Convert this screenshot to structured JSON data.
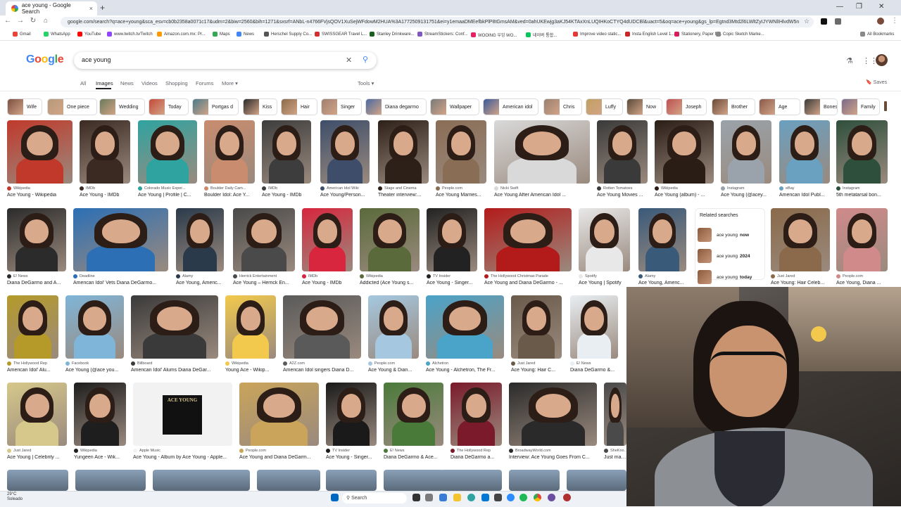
{
  "browser": {
    "tab_title": "ace young - Google Search",
    "tab_close": "×",
    "new_tab": "+",
    "url": "google.com/search?q=ace+young&sca_esv=cb0b2358a0071c17&udm=2&biw=2560&bih=1271&sxsrf=ANbL-n4766FVjsQOV1XuSejWFdowM2HUA%3A1772509131751&ei=y1emaaDMEefbkPlP8tGmsAM&ved=0ahUKEwjg3aKJ54KTAxXnLUQIHKoCTYQ4dUDCBl&uact=5&oq=ace+young&gs_lp=Egtnd3Mtd2l6LWltZyIJYWNlIHlvdW5n",
    "nav": {
      "back": "←",
      "forward": "→",
      "reload": "↻",
      "home": "⌂"
    },
    "window_controls": {
      "minimize": "—",
      "restore": "❐",
      "close": "✕"
    },
    "bookmarks": [
      "Gmail",
      "WhatsApp",
      "YouTube",
      "www.twitch.tv/Twitch",
      "Amazon.com.mx: Pr...",
      "Maps",
      "News",
      "Herschel Supply Co...",
      "SWISSGEAR Travel L...",
      "Stanley Drinkware...",
      "StreamStickers: Conf...",
      "WOOING 우잉 WO...",
      "네이버 통합...",
      "Improve video static...",
      "Insta English Level 1...",
      "Stationery, Paper fo...",
      "Copic Sketch Marke..."
    ],
    "all_bookmarks": "All Bookmarks"
  },
  "google": {
    "logo": {
      "letters": [
        "G",
        "o",
        "o",
        "g",
        "l",
        "e"
      ],
      "colors": [
        "#4285f4",
        "#ea4335",
        "#fbbc05",
        "#4285f4",
        "#34a853",
        "#ea4335"
      ]
    },
    "query": "ace young",
    "clear_icon": "✕",
    "search_icon": "⚲",
    "tabs": [
      "All",
      "Images",
      "News",
      "Videos",
      "Shopping",
      "Forums",
      "More ▾"
    ],
    "active_tab": "Images",
    "tools": "Tools ▾",
    "saves": "Saves",
    "chips": [
      "Wife",
      "One piece",
      "Wedding",
      "Today",
      "Portgas d",
      "Kiss",
      "Hair",
      "Singer",
      "Diana degarmo",
      "Wallpaper",
      "American idol",
      "Chris",
      "Luffy",
      "Now",
      "Joseph",
      "Brother",
      "Age",
      "Bones",
      "Family"
    ],
    "related": {
      "heading": "Related searches",
      "items": [
        {
          "base": "ace young",
          "bold": "now"
        },
        {
          "base": "ace young",
          "bold": "2024"
        },
        {
          "base": "ace young",
          "bold": "today"
        }
      ]
    },
    "results": [
      {
        "source": "Wikipedia",
        "title": "Ace Young - Wikipedia",
        "accent": "#c0392b"
      },
      {
        "source": "IMDb",
        "title": "Ace Young - IMDb",
        "accent": "#3b2a22"
      },
      {
        "source": "Colorado Music Exper...",
        "title": "Ace Young | Profile | C...",
        "accent": "#2fa3a0"
      },
      {
        "source": "Boulder Daily Cam...",
        "title": "Boulder Idol: Ace Y...",
        "accent": "#c98c6e"
      },
      {
        "source": "IMDb",
        "title": "Ace Young - IMDb",
        "accent": "#3d3d3d"
      },
      {
        "source": "American Idol Wiki",
        "title": "Ace Young/Person...",
        "accent": "#3e4e6a"
      },
      {
        "source": "Stage and Cinema",
        "title": "Theater interview:...",
        "accent": "#2d2018"
      },
      {
        "source": "People.com",
        "title": "Ace Young Marries...",
        "accent": "#8a6d55"
      },
      {
        "source": "Nicki Swift",
        "title": "Ace Young After American Idol ...",
        "accent": "#d9d9d9"
      },
      {
        "source": "Rotten Tomatoes",
        "title": "Ace Young Movies ...",
        "accent": "#3a3a3a"
      },
      {
        "source": "Wikipedia",
        "title": "Ace Young (album) - ...",
        "accent": "#2a1d15"
      },
      {
        "source": "Instagram",
        "title": "Ace Young (@acey...",
        "accent": "#9aa3ab"
      },
      {
        "source": "eBay",
        "title": "American Idol Publ...",
        "accent": "#6aa0c0"
      },
      {
        "source": "Instagram",
        "title": "5th metatarsal bon...",
        "accent": "#2e4f3c"
      },
      {
        "source": "E! News",
        "title": "Diana DeGarmo and A...",
        "accent": "#2b2b2b"
      },
      {
        "source": "Deadline",
        "title": "American Idol' Vets Diana DeGarmo...",
        "accent": "#2c6fb5"
      },
      {
        "source": "Alamy",
        "title": "Ace Young, Americ...",
        "accent": "#2a3a4a"
      },
      {
        "source": "Herrick Entertainment",
        "title": "Ace Young – Herrick En...",
        "accent": "#4a4a4a"
      },
      {
        "source": "IMDb",
        "title": "Ace Young - IMDb",
        "accent": "#d7263d"
      },
      {
        "source": "Wikipedia",
        "title": "Addicted (Ace Young s...",
        "accent": "#5a6a3a"
      },
      {
        "source": "TV Insider",
        "title": "Ace Young - Singer...",
        "accent": "#222222"
      },
      {
        "source": "The Hollywood Christmas Parade",
        "title": "Ace Young and Diana DeGarmo - ...",
        "accent": "#b31b1b"
      },
      {
        "source": "Spotify",
        "title": "Ace Young | Spotify",
        "accent": "#e8e8e8"
      },
      {
        "source": "Alamy",
        "title": "Ace Young, Americ...",
        "accent": "#3a5a7a"
      },
      {
        "source": "Just Jared",
        "title": "Ace Young: Hair Celeb...",
        "accent": "#8a6a4a"
      },
      {
        "source": "People.com",
        "title": "Ace Young, Diana ...",
        "accent": "#d08a8a"
      },
      {
        "source": "The Hollywood Rep",
        "title": "American Idol' Alu...",
        "accent": "#b59a2a"
      },
      {
        "source": "Facebook",
        "title": "Ace Young (@ace you...",
        "accent": "#7fb5d8"
      },
      {
        "source": "Billboard",
        "title": "American Idol' Alums Diana DeGar...",
        "accent": "#3a3a3a"
      },
      {
        "source": "Wikipedia",
        "title": "Young Ace - Wikip...",
        "accent": "#f2c94c"
      },
      {
        "source": "A2Z.com",
        "title": "American Idol singers Diana D...",
        "accent": "#5a5a5a"
      },
      {
        "source": "People.com",
        "title": "Ace Young & Dian...",
        "accent": "#a5c8e0"
      },
      {
        "source": "Alchetron",
        "title": "Ace Young - Alchetron, The Fr...",
        "accent": "#4aa3c8"
      },
      {
        "source": "Just Jared",
        "title": "Ace Young: Hair C...",
        "accent": "#6a5a4a"
      },
      {
        "source": "E! News",
        "title": "Diana DeGarmo &...",
        "accent": "#e9eef2"
      },
      {
        "source": "Just Jared",
        "title": "Ace Young | Celebrity ...",
        "accent": "#d6c88a"
      },
      {
        "source": "Wikipedia",
        "title": "Yungeen Ace - Wik...",
        "accent": "#1e1e1e"
      },
      {
        "source": "Apple Music",
        "title": "Ace Young - Album by Ace Young - Apple...",
        "accent": "#f2f2f2"
      },
      {
        "source": "People.com",
        "title": "Ace Young and Diana DeGarm...",
        "accent": "#c9a45a"
      },
      {
        "source": "TV Insider",
        "title": "Ace Young - Singer...",
        "accent": "#1a1a1a"
      },
      {
        "source": "E! News",
        "title": "Diana DeGarmo & Ace...",
        "accent": "#4a7a3a"
      },
      {
        "source": "The Hollywood Rep",
        "title": "Diana DeGarmo a...",
        "accent": "#7a1a2a"
      },
      {
        "source": "BroadwayWorld.com",
        "title": "Interview: Ace Young Goes From C...",
        "accent": "#2a2a2a"
      },
      {
        "source": "SheKno...",
        "title": "Just marr...",
        "accent": "#4a4a4a"
      }
    ],
    "album_cover_text": "ACE YOUNG"
  },
  "taskbar": {
    "weather_temp": "29°C",
    "weather_desc": "Soleado",
    "search_label": "Search"
  }
}
